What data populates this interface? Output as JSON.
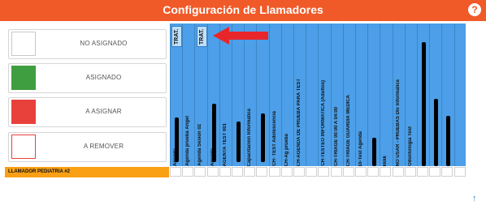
{
  "header": {
    "title": "Configuración de Llamadores",
    "help_icon": "?"
  },
  "legend": [
    {
      "label": "NO ASIGNADO",
      "color": "#ffffff",
      "border": "#c8c8c8"
    },
    {
      "label": "ASIGNADO",
      "color": "#3f9e3f",
      "border": "#3f9e3f"
    },
    {
      "label": "A ASIGNAR",
      "color": "#e8413c",
      "border": "#e8413c"
    },
    {
      "label": "A REMOVER",
      "color": "#ffffff",
      "border": "#e8413c"
    }
  ],
  "trat_label": "TRAT.",
  "columns": [
    "Agenda",
    "Agenda prueba Angel",
    "Agenda Sesion 02",
    "Agenda",
    "AGENTA TEST 001",
    "",
    "Capacitacion Informatica",
    "",
    "CH- TEST Adolescencia",
    "CH-Ag prueba",
    "CH-AGENDA DE PRUEBA PARA TEST",
    "",
    "CH-TESTEO INFORMATICA (Adultos)",
    "CH-TRIAGE 00:00 A 04:00",
    "CH-TRIAGE GUARDIA MEDICA",
    "Di-Test Agenda",
    "",
    "kkkk",
    "NO USAR - PRUEBAS Div Informatica",
    "Odontologia Test",
    "",
    "",
    "",
    ""
  ],
  "row": {
    "label": "LLAMADOR PEDIATRIA #2"
  },
  "colors": {
    "header": "#f05a28",
    "grid": "#4c9fe8",
    "row_label": "#f9a014",
    "arrow": "#e8262a"
  },
  "icons": {
    "help": "help-circle-icon",
    "scroll_top": "arrow-up-icon",
    "pointer": "arrow-left-icon"
  }
}
